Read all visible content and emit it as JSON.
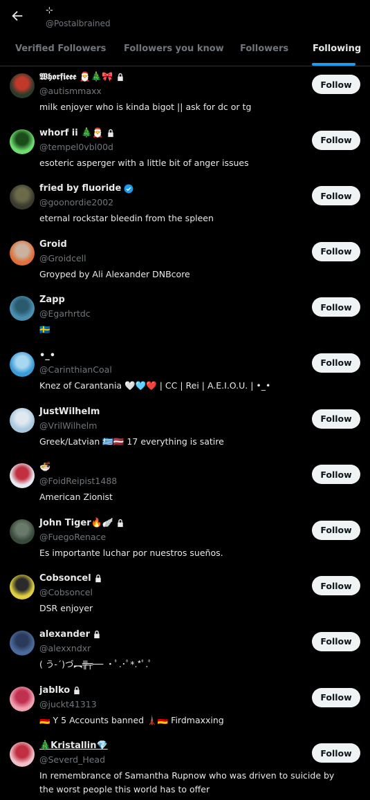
{
  "header": {
    "title_symbol": "⊹",
    "handle": "@Postalbrained"
  },
  "tabs": [
    {
      "label": "Verified Followers"
    },
    {
      "label": "Followers you know"
    },
    {
      "label": "Followers"
    },
    {
      "label": "Following"
    }
  ],
  "active_tab": "Following",
  "colors": {
    "accent": "#1d9bf0",
    "follow_button_bg": "#eff3f4",
    "secondary_text": "#71767b"
  },
  "follow_label": "Follow",
  "users": [
    {
      "name": "𝖂𝖍𝖔𝖗𝖋𝖎𝖊𝖊𝖊 🎅🎄🎀",
      "locked": true,
      "verified": false,
      "handle": "@autismmaxx",
      "bio": "milk enjoyer who is kinda bigot || ask for dc or tg",
      "avatar_colors": [
        "#2a3b2a",
        "#c0392b"
      ]
    },
    {
      "name": "whorf ii 🎄🎅",
      "locked": true,
      "verified": false,
      "handle": "@tempel0vbl00d",
      "bio": "esoteric asperger with a little bit of anger issues",
      "avatar_colors": [
        "#6ddb6d",
        "#1a4d1a"
      ]
    },
    {
      "name": "fried by fluoride",
      "locked": false,
      "verified": true,
      "handle": "@goonordie2002",
      "bio": "eternal rockstar bleedin from the spleen",
      "avatar_colors": [
        "#3a3a2e",
        "#6b6b4a"
      ]
    },
    {
      "name": "Groid",
      "locked": false,
      "verified": false,
      "handle": "@Groidcell",
      "bio": "Groyped by Ali Alexander DNBcore",
      "avatar_colors": [
        "#e0703a",
        "#c9b3a0"
      ]
    },
    {
      "name": "Zapp",
      "locked": false,
      "verified": false,
      "handle": "@Egarhrtdc",
      "bio": "🇸🇪",
      "avatar_colors": [
        "#4a8fb0",
        "#2a5a6e"
      ]
    },
    {
      "name": "•_•",
      "locked": false,
      "verified": false,
      "handle": "@CarinthianCoal",
      "bio": "Knez of Carantania 🤍🩵❤️ | CC | Rei | A.E.I.O.U. | •_•",
      "avatar_colors": [
        "#3a9bd9",
        "#a8d8f0"
      ]
    },
    {
      "name": "JustWilhelm",
      "locked": false,
      "verified": false,
      "handle": "@VrilWilhelm",
      "bio": "Greek/Latvian 🇬🇷🇱🇻 17 everything is satire",
      "avatar_colors": [
        "#a8c8e0",
        "#e0e8f0"
      ]
    },
    {
      "name": "🍜",
      "locked": false,
      "verified": false,
      "handle": "@FoidReipist1488",
      "bio": "American Zionist",
      "avatar_colors": [
        "#e8e8f0",
        "#c03040"
      ]
    },
    {
      "name": "John Tiger🔥🪽",
      "locked": true,
      "verified": false,
      "handle": "@FuegoRenace",
      "bio": "Es importante luchar por nuestros sueños.",
      "avatar_colors": [
        "#3a4a3a",
        "#6a7a6a"
      ]
    },
    {
      "name": "Cobsoncel",
      "locked": true,
      "verified": false,
      "handle": "@Cobsoncel",
      "bio": "DSR enjoyer",
      "avatar_colors": [
        "#e0d040",
        "#2a2a2a"
      ]
    },
    {
      "name": "alexander",
      "locked": true,
      "verified": false,
      "handle": "@alexxndxr",
      "bio": "( う-´)づ︻╦̵̵̿╤── ・ﾟ.･ﾟ*.*ﾟ.ﾟ",
      "avatar_colors": [
        "#4a6a9a",
        "#2a3a5a"
      ]
    },
    {
      "name": "jablko",
      "locked": true,
      "verified": false,
      "handle": "@juckt41313",
      "bio": "🇩🇪 Y 5 Accounts banned 🗼🇩🇪 Firdmaxxing",
      "avatar_colors": [
        "#f0a0b0",
        "#c03050"
      ]
    },
    {
      "name": "🎄Kristallin💎",
      "locked": false,
      "verified": false,
      "underline": true,
      "handle": "@Severd_Head",
      "bio": "In remembrance of Samantha Rupnow who was driven to suicide by the worst people this world has to offer",
      "avatar_colors": [
        "#f0c0c8",
        "#c03040"
      ]
    }
  ]
}
